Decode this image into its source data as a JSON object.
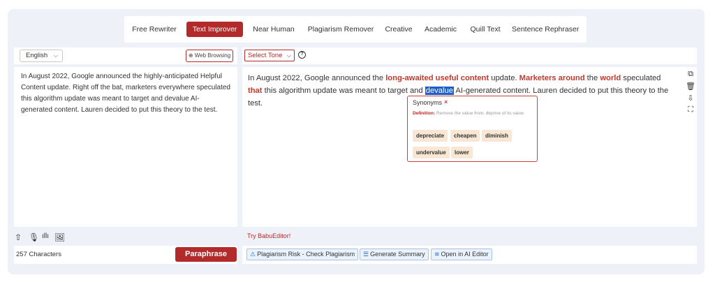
{
  "nav": {
    "tabs": [
      {
        "label": "Free Rewriter",
        "active": false
      },
      {
        "label": "Text Improver",
        "active": true
      },
      {
        "label": "Near Human",
        "active": false
      },
      {
        "label": "Plagiarism Remover",
        "active": false
      },
      {
        "label": "Creative",
        "active": false
      },
      {
        "label": "Academic",
        "active": false
      },
      {
        "label": "Quill Text",
        "active": false
      },
      {
        "label": "Sentence Rephraser",
        "active": false
      }
    ]
  },
  "left": {
    "language": "English",
    "web_browsing": "Web Browsing",
    "input_text": "In August 2022, Google announced the highly-anticipated Helpful Content update. Right off the bat, marketers everywhere speculated this algorithm update was meant to target and devalue AI-generated content. Lauren decided to put this theory to the test.",
    "char_count": "257 Characters",
    "paraphrase_label": "Paraphrase",
    "icons": [
      "cloud-upload-icon",
      "microphone-icon",
      "audio-wave-icon",
      "image-icon"
    ]
  },
  "right": {
    "tone_select": "Select Tone",
    "output": {
      "s1": "In August 2022, Google announced the ",
      "h1": "long-awaited useful content",
      "s2": " update. ",
      "h2": "Marketers around",
      "s3": " the ",
      "h3": "world",
      "s4": " speculated ",
      "h4": "that",
      "s5": " this algorithm update was meant to target and ",
      "selected": "devalue",
      "s6": " AI-generated content. Lauren decided to put this theory to the test."
    },
    "side_icons": [
      "copy-icon",
      "trash-icon",
      "cloud-download-icon",
      "fullscreen-icon"
    ],
    "synonyms": {
      "title": "Synonyms",
      "close": "×",
      "definition_label": "Definition:",
      "definition": "Remove the value from; deprive of its value",
      "words": [
        "depreciate",
        "cheapen",
        "diminish",
        "undervalue",
        "lower"
      ]
    },
    "try_link": "Try BabuEditor!",
    "actions": [
      {
        "icon": "⚠",
        "label": "Plagiarism Risk - Check Plagiarism"
      },
      {
        "icon": "☰",
        "label": "Generate Summary"
      },
      {
        "icon": "≋",
        "label": "Open in AI Editor"
      }
    ]
  }
}
